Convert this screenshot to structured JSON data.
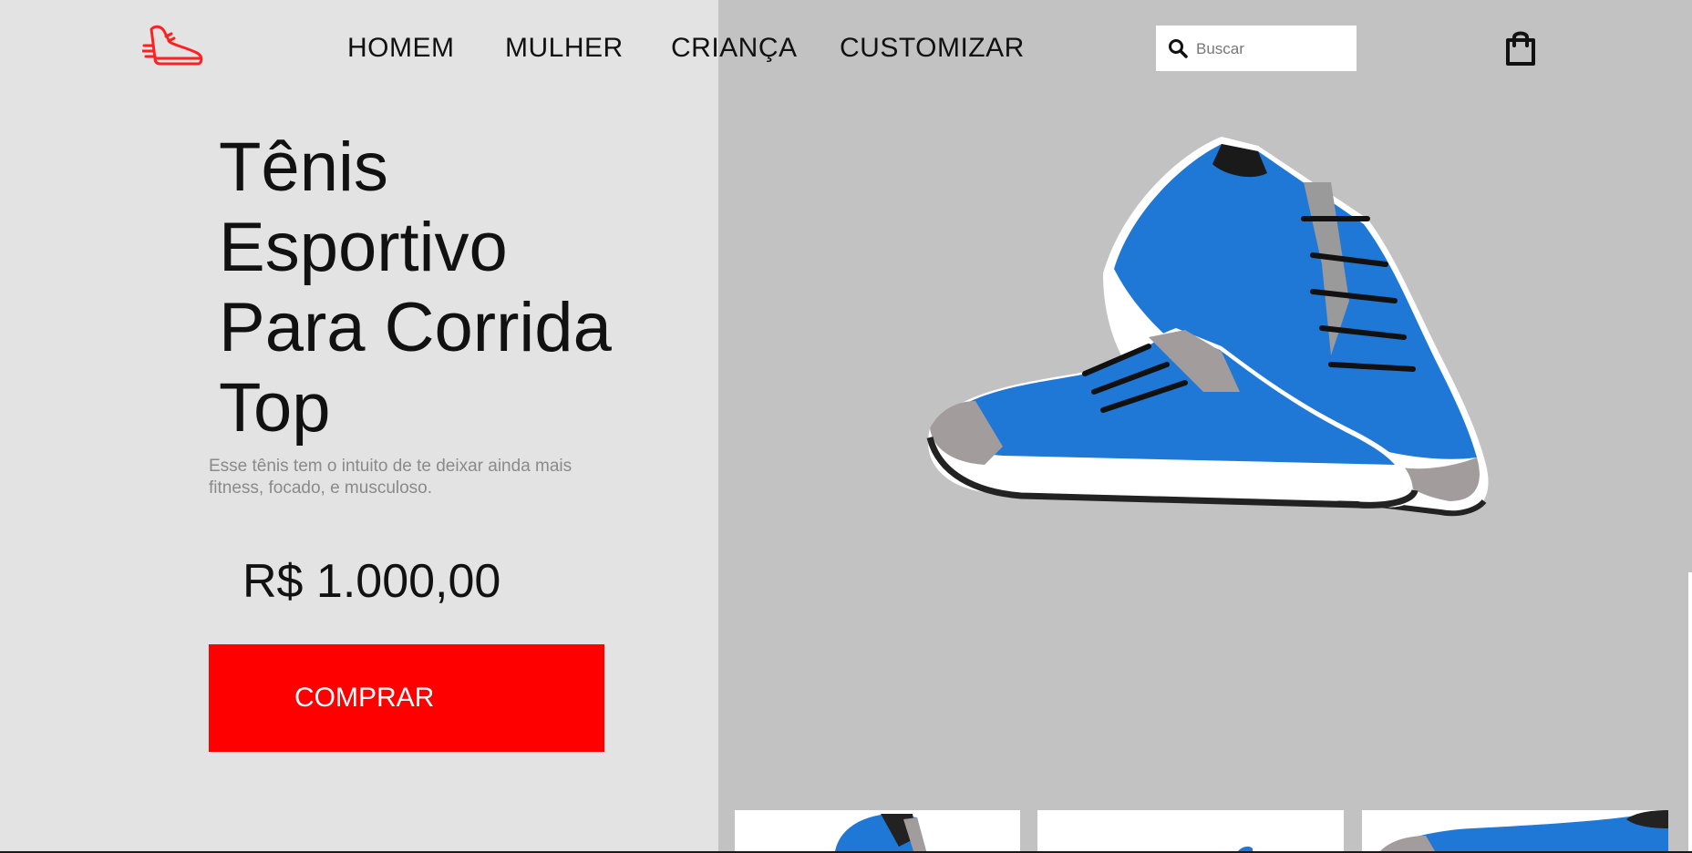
{
  "nav": {
    "links": [
      "HOMEM",
      "MULHER",
      "CRIANÇA",
      "CUSTOMIZAR"
    ]
  },
  "search": {
    "placeholder": "Buscar"
  },
  "hero": {
    "title_lines": [
      "Tênis",
      "Esportivo",
      "Para Corrida",
      "Top"
    ],
    "description": "Esse tênis tem o intuito de te deixar ainda mais fitness, focado, e musculoso.",
    "price": "R$ 1.000,00",
    "buy_label": "COMPRAR"
  },
  "icons": {
    "logo": "running-shoe-logo",
    "search": "search-icon",
    "cart": "shopping-bag-icon"
  },
  "colors": {
    "accent": "#ff0000",
    "left_bg": "#e3e3e3",
    "right_bg": "#c2c2c2",
    "shoe_blue": "#1f78d6"
  }
}
